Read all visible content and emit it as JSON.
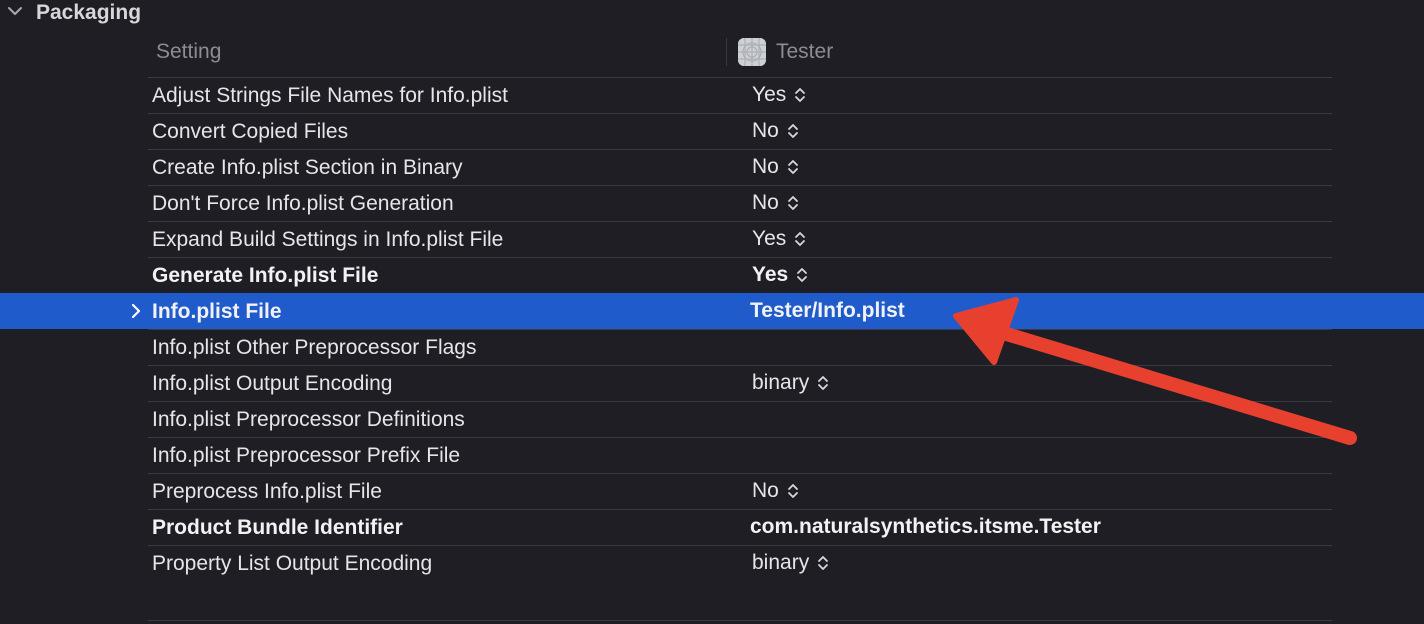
{
  "section": {
    "title": "Packaging",
    "chevron_icon": "chevron-down-icon"
  },
  "columns": {
    "setting": "Setting",
    "target": "Tester",
    "target_icon": "app-target-icon"
  },
  "rows": [
    {
      "name": "Adjust Strings File Names for Info.plist",
      "value": "Yes",
      "stepper": true,
      "bold": false
    },
    {
      "name": "Convert Copied Files",
      "value": "No",
      "stepper": true,
      "bold": false
    },
    {
      "name": "Create Info.plist Section in Binary",
      "value": "No",
      "stepper": true,
      "bold": false
    },
    {
      "name": "Don't Force Info.plist Generation",
      "value": "No",
      "stepper": true,
      "bold": false
    },
    {
      "name": "Expand Build Settings in Info.plist File",
      "value": "Yes",
      "stepper": true,
      "bold": false
    },
    {
      "name": "Generate Info.plist File",
      "value": "Yes",
      "stepper": true,
      "bold": true
    },
    {
      "name": "Info.plist File",
      "value": "Tester/Info.plist",
      "stepper": false,
      "bold": true,
      "selected": true,
      "expandable": true
    },
    {
      "name": "Info.plist Other Preprocessor Flags",
      "value": "",
      "stepper": false,
      "bold": false
    },
    {
      "name": "Info.plist Output Encoding",
      "value": "binary",
      "stepper": true,
      "bold": false
    },
    {
      "name": "Info.plist Preprocessor Definitions",
      "value": "",
      "stepper": false,
      "bold": false
    },
    {
      "name": "Info.plist Preprocessor Prefix File",
      "value": "",
      "stepper": false,
      "bold": false
    },
    {
      "name": "Preprocess Info.plist File",
      "value": "No",
      "stepper": true,
      "bold": false
    },
    {
      "name": "Product Bundle Identifier",
      "value": "com.naturalsynthetics.itsme.Tester",
      "stepper": false,
      "bold": true
    },
    {
      "name": "Property List Output Encoding",
      "value": "binary",
      "stepper": true,
      "bold": false
    }
  ],
  "colors": {
    "background": "#1f1e24",
    "selection": "#1f5bcb",
    "annotation_arrow": "#e8402f"
  }
}
